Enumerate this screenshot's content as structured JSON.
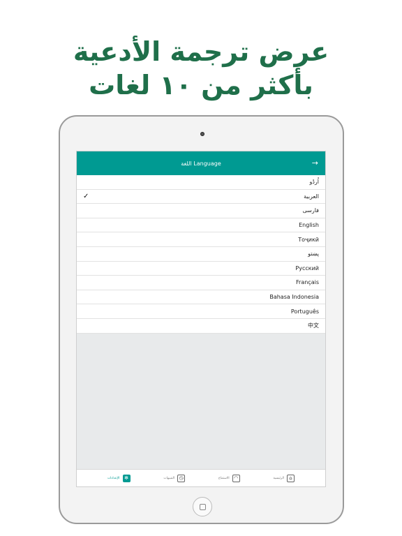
{
  "headline": {
    "line1": "عرض ترجمة الأدعية",
    "line2": "بأكثر من ١٠ لغات"
  },
  "header": {
    "title": "اللغة Language",
    "back_icon": "arrow-right-icon"
  },
  "languages": [
    {
      "label": "اُردُو",
      "selected": false
    },
    {
      "label": "العربية",
      "selected": true
    },
    {
      "label": "فارسی",
      "selected": false
    },
    {
      "label": "English",
      "selected": false
    },
    {
      "label": "Тоҷикӣ",
      "selected": false
    },
    {
      "label": "پښتو",
      "selected": false
    },
    {
      "label": "Русский",
      "selected": false
    },
    {
      "label": "Français",
      "selected": false
    },
    {
      "label": "Bahasa Indonesia",
      "selected": false
    },
    {
      "label": "Português",
      "selected": false
    },
    {
      "label": "中文",
      "selected": false
    }
  ],
  "check_glyph": "✓",
  "tabs": [
    {
      "label": "الرئيسية",
      "icon": "home-icon",
      "active": false
    },
    {
      "label": "الاستماع",
      "icon": "headphones-icon",
      "active": false
    },
    {
      "label": "التنبيهات",
      "icon": "alarm-clock-icon",
      "active": false
    },
    {
      "label": "الإعدادات",
      "icon": "gear-icon",
      "active": true
    }
  ],
  "colors": {
    "accent": "#009a92",
    "headline": "#1f6f4a"
  }
}
